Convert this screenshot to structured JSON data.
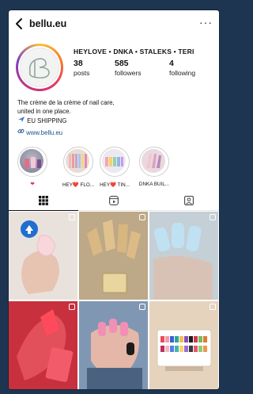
{
  "header": {
    "username": "bellu.eu",
    "more_label": "···"
  },
  "profile": {
    "display_name": "HEYLOVE • DNKA • STALEKS • TERI",
    "stats": [
      {
        "value": "38",
        "label": "posts"
      },
      {
        "value": "585",
        "label": "followers"
      },
      {
        "value": "4",
        "label": "following"
      }
    ],
    "bio_line1": "The crème de la crème of nail care,",
    "bio_line2": "united in one place.",
    "shipping": "EU SHIPPING",
    "link": "www.bellu.eu"
  },
  "highlights": [
    {
      "label": ""
    },
    {
      "label": "HEY❤️ FLO..."
    },
    {
      "label": "HEY❤️ TIN..."
    },
    {
      "label": "DNKA BUIL..."
    }
  ],
  "highlight_colors": [
    "#e1306c",
    "#c9a98e",
    "#d9c7e6",
    "#e8b7c7"
  ],
  "tabs": [
    "grid-icon",
    "reels-icon",
    "tagged-icon"
  ],
  "brand_colors": {
    "link": "#1a4f8a",
    "ring_start": "#f9c23c",
    "ring_end": "#c13584",
    "background": "#1d3550"
  }
}
